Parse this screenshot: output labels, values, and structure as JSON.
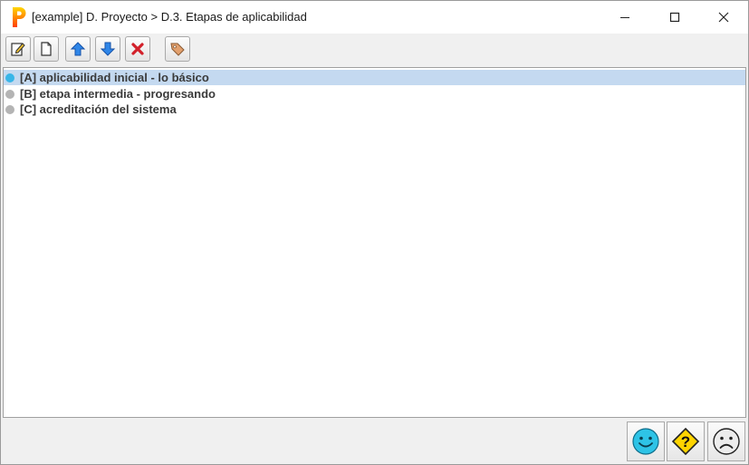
{
  "window": {
    "title": "[example] D. Proyecto > D.3. Etapas de aplicabilidad",
    "app_logo_letter": "P"
  },
  "toolbar": {
    "buttons": [
      {
        "name": "edit",
        "icon": "edit-icon"
      },
      {
        "name": "new",
        "icon": "new-document-icon"
      },
      {
        "name": "move-up",
        "icon": "arrow-up-icon"
      },
      {
        "name": "move-down",
        "icon": "arrow-down-icon"
      },
      {
        "name": "delete",
        "icon": "delete-x-icon"
      },
      {
        "name": "tag",
        "icon": "tag-icon"
      }
    ]
  },
  "list": {
    "items": [
      {
        "label": "[A] aplicabilidad inicial - lo básico",
        "selected": true,
        "bullet_color": "#38b6e8"
      },
      {
        "label": "[B] etapa intermedia - progresando",
        "selected": false,
        "bullet_color": "#b4b4b4"
      },
      {
        "label": "[C] acreditación del sistema",
        "selected": false,
        "bullet_color": "#b4b4b4"
      }
    ]
  },
  "statusbar": {
    "buttons": [
      {
        "name": "happy",
        "icon": "smiley-face-icon"
      },
      {
        "name": "help",
        "icon": "question-sign-icon"
      },
      {
        "name": "sad",
        "icon": "sad-face-icon"
      }
    ]
  },
  "colors": {
    "selection": "#c4d9f0",
    "accent_blue": "#1e6fd9",
    "delete_red": "#d2202a",
    "smiley": "#2ec3e6",
    "warning_yellow": "#ffd400"
  }
}
